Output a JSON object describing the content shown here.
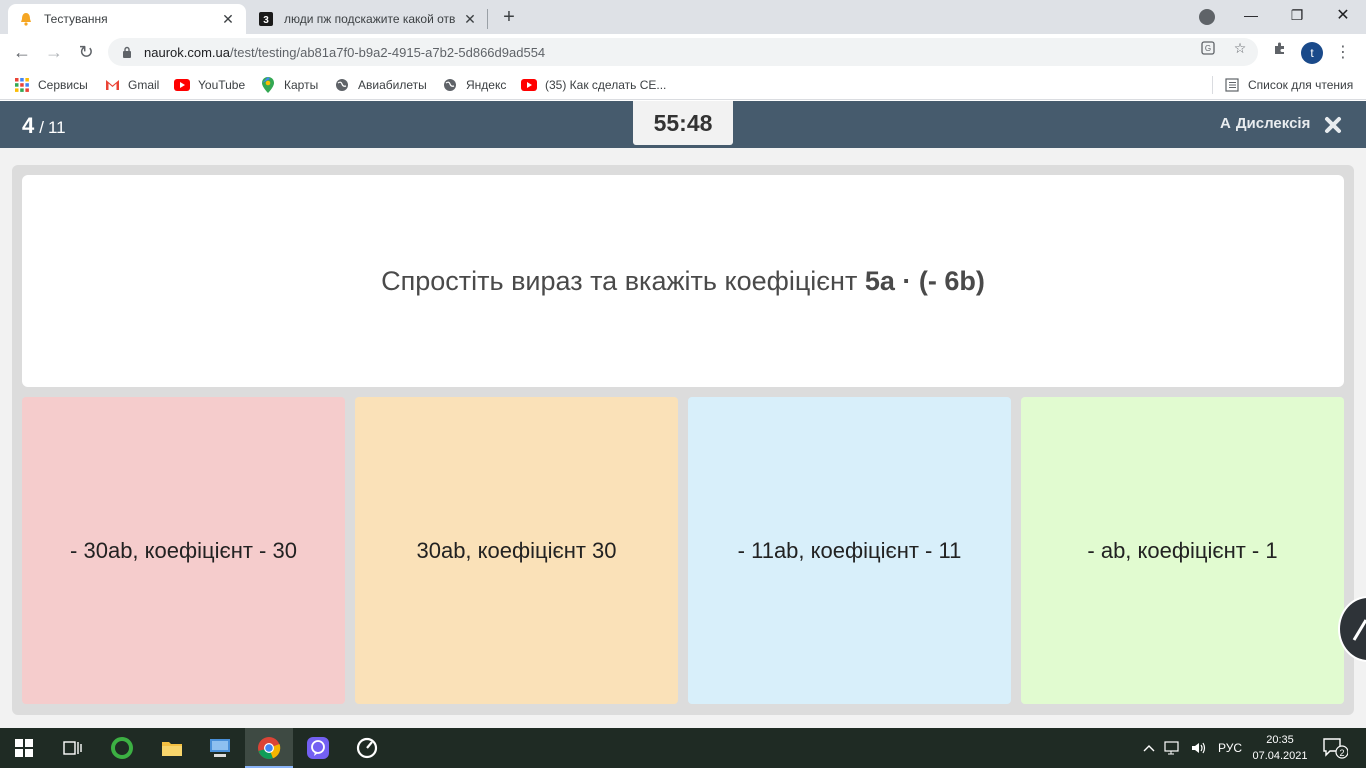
{
  "browser": {
    "tabs": [
      {
        "title": "Тестування",
        "favicon": "bell-icon",
        "active": true
      },
      {
        "title": "люди пж подскажите какой отв",
        "favicon": "znanija-3-icon",
        "active": false
      }
    ],
    "url_host": "naurok.com.ua",
    "url_path": "/test/testing/ab81a7f0-b9a2-4915-a7b2-5d866d9ad554",
    "profile_initial": "t",
    "bookmarks": [
      {
        "label": "Сервисы",
        "icon": "apps-grid-icon"
      },
      {
        "label": "Gmail",
        "icon": "gmail-icon"
      },
      {
        "label": "YouTube",
        "icon": "youtube-icon"
      },
      {
        "label": "Карты",
        "icon": "maps-icon"
      },
      {
        "label": "Авиабилеты",
        "icon": "globe-icon"
      },
      {
        "label": "Яндекс",
        "icon": "globe-icon"
      },
      {
        "label": "(35) Как сделать CE...",
        "icon": "youtube-icon"
      }
    ],
    "reading_list": "Список для чтения"
  },
  "quiz": {
    "current": "4",
    "total": "11",
    "timer": "55:48",
    "dyslexia_label": "Дислексія",
    "question_prefix": "Спростіть вираз та вкажіть коефіцієнт ",
    "question_expression": "5a · (- 6b)",
    "answers": [
      {
        "text": "- 30ab, коефіцієнт - 30",
        "color": "#f5cccc"
      },
      {
        "text": "30ab, коефіцієнт 30",
        "color": "#fae1b8"
      },
      {
        "text": "- 11ab, коефіцієнт - 11",
        "color": "#d8effa"
      },
      {
        "text": "- ab, коефіцієнт - 1",
        "color": "#e1fbd0"
      }
    ],
    "header_color": "#465b6d"
  },
  "taskbar": {
    "apps": [
      "windows-start-icon",
      "task-view-icon",
      "green-ring-app-icon",
      "file-explorer-icon",
      "computer-icon",
      "chrome-icon",
      "viber-icon",
      "clock-app-icon"
    ],
    "language": "РУС",
    "time": "20:35",
    "date": "07.04.2021",
    "notifications": "2"
  }
}
